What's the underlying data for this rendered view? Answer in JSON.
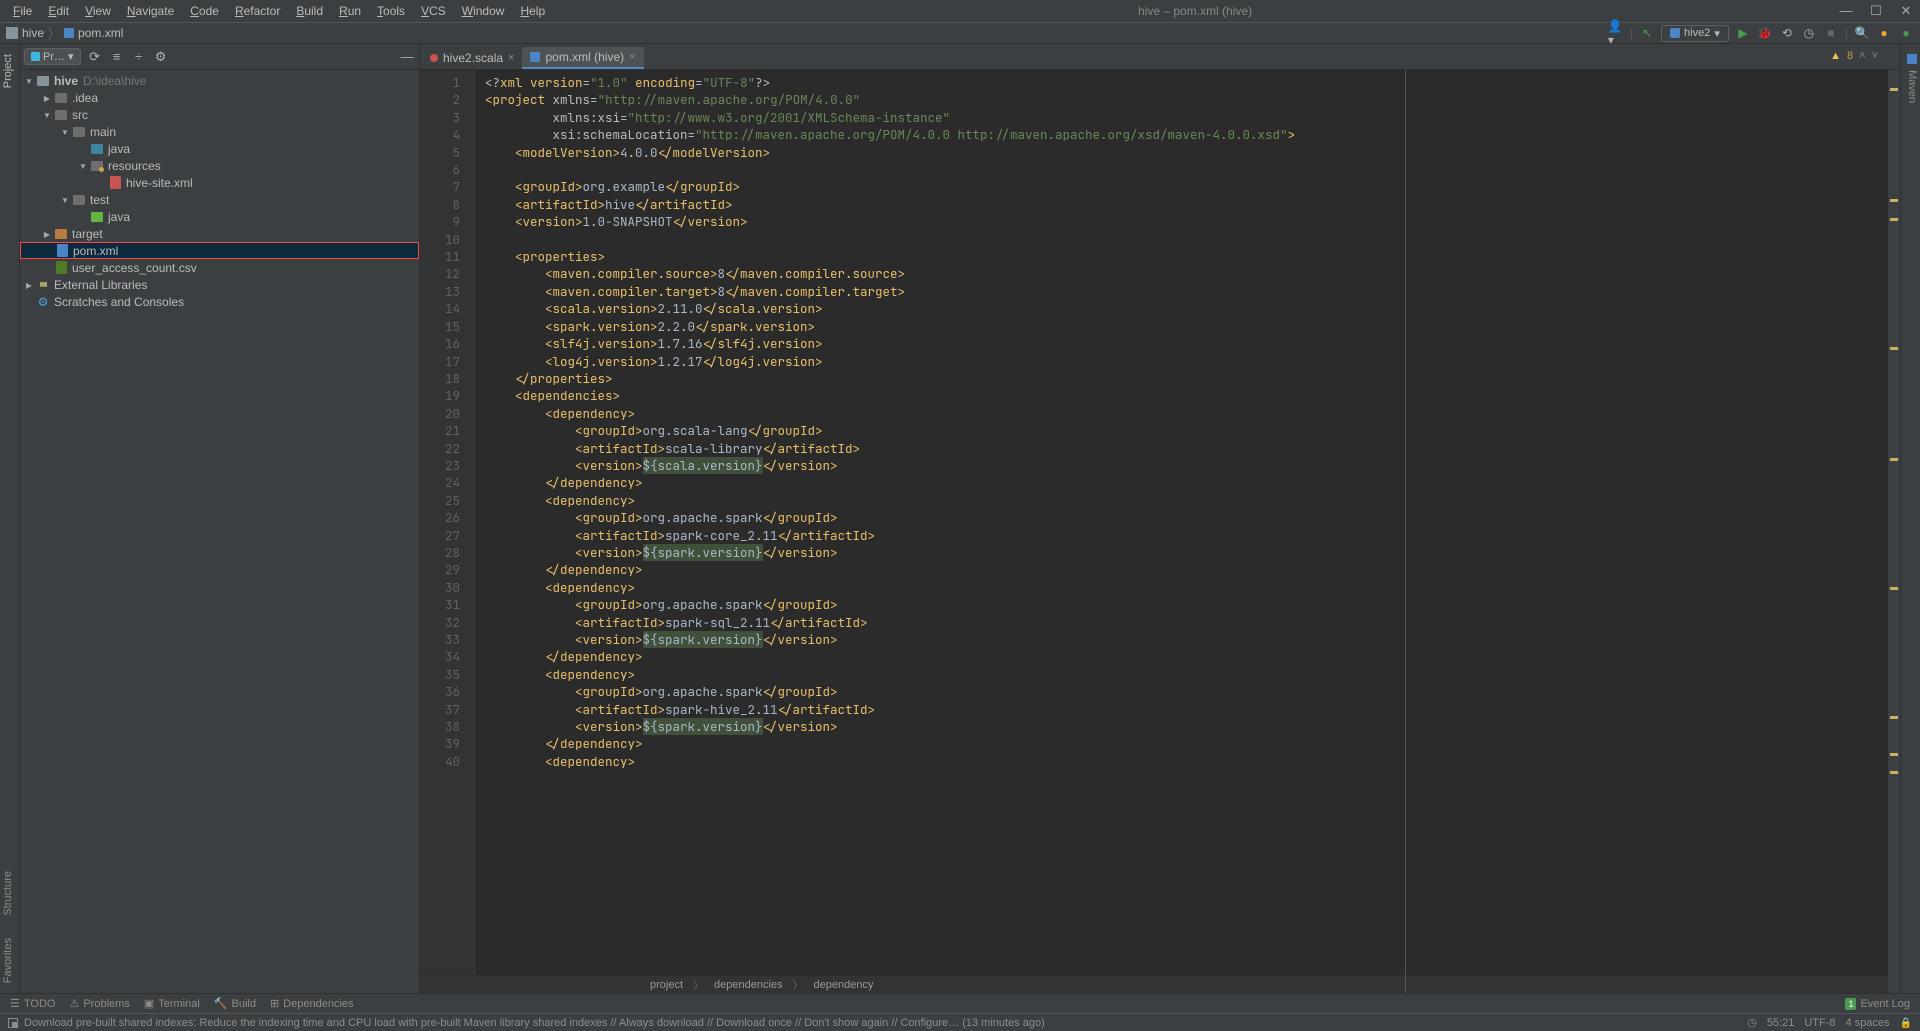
{
  "titlebar": {
    "menu": [
      "File",
      "Edit",
      "View",
      "Navigate",
      "Code",
      "Refactor",
      "Build",
      "Run",
      "Tools",
      "VCS",
      "Window",
      "Help"
    ],
    "center": "hive – pom.xml (hive)"
  },
  "navbar": {
    "crumb1": "hive",
    "crumb2": "pom.xml",
    "run_label": "hive2"
  },
  "project_header": {
    "label": "Pr…"
  },
  "tree": {
    "root": "hive",
    "root_path": "D:\\idea\\hive",
    "idea": ".idea",
    "src": "src",
    "main": "main",
    "java": "java",
    "resources": "resources",
    "hive_site": "hive-site.xml",
    "test": "test",
    "test_java": "java",
    "target": "target",
    "pom": "pom.xml",
    "csv": "user_access_count.csv",
    "libs": "External Libraries",
    "scratches": "Scratches and Consoles"
  },
  "tabs": {
    "t1": "hive2.scala",
    "t2": "pom.xml (hive)"
  },
  "warnings": {
    "count": "8"
  },
  "code_lines": [
    {
      "n": 1,
      "html": "<span class='pi'>&lt;?</span><span class='tag'>xml version</span>=<span class='str'>\"1.0\"</span> <span class='tag'>encoding</span>=<span class='str'>\"UTF-8\"</span><span class='pi'>?&gt;</span>"
    },
    {
      "n": 2,
      "html": "<span class='tag'>&lt;project</span> <span class='attr'>xmlns</span>=<span class='str'>\"http://maven.apache.org/POM/4.0.0\"</span>"
    },
    {
      "n": 3,
      "html": "         <span class='attr'>xmlns:xsi</span>=<span class='str'>\"http://www.w3.org/2001/XMLSchema-instance\"</span>"
    },
    {
      "n": 4,
      "html": "         <span class='attr'>xsi:schemaLocation</span>=<span class='str'>\"http://maven.apache.org/POM/4.0.0 http://maven.apache.org/xsd/maven-4.0.0.xsd\"</span><span class='tag'>&gt;</span>"
    },
    {
      "n": 5,
      "html": "    <span class='tag'>&lt;modelVersion&gt;</span>4.0.0<span class='tag'>&lt;/modelVersion&gt;</span>"
    },
    {
      "n": 6,
      "html": ""
    },
    {
      "n": 7,
      "html": "    <span class='tag'>&lt;groupId&gt;</span>org.example<span class='tag'>&lt;/groupId&gt;</span>"
    },
    {
      "n": 8,
      "html": "    <span class='tag'>&lt;artifactId&gt;</span>hive<span class='tag'>&lt;/artifactId&gt;</span>"
    },
    {
      "n": 9,
      "html": "    <span class='tag'>&lt;version&gt;</span>1.0-SNAPSHOT<span class='tag'>&lt;/version&gt;</span>"
    },
    {
      "n": 10,
      "html": ""
    },
    {
      "n": 11,
      "html": "    <span class='tag'>&lt;properties&gt;</span>"
    },
    {
      "n": 12,
      "html": "        <span class='tag'>&lt;maven.compiler.source&gt;</span>8<span class='tag'>&lt;/maven.compiler.source&gt;</span>"
    },
    {
      "n": 13,
      "html": "        <span class='tag'>&lt;maven.compiler.target&gt;</span>8<span class='tag'>&lt;/maven.compiler.target&gt;</span>"
    },
    {
      "n": 14,
      "html": "        <span class='tag'>&lt;scala.version&gt;</span>2.11.0<span class='tag'>&lt;/scala.version&gt;</span>"
    },
    {
      "n": 15,
      "html": "        <span class='tag'>&lt;spark.version&gt;</span>2.2.0<span class='tag'>&lt;/spark.version&gt;</span>"
    },
    {
      "n": 16,
      "html": "        <span class='tag'>&lt;slf4j.version&gt;</span>1.7.16<span class='tag'>&lt;/slf4j.version&gt;</span>"
    },
    {
      "n": 17,
      "html": "        <span class='tag'>&lt;log4j.version&gt;</span>1.2.17<span class='tag'>&lt;/log4j.version&gt;</span>"
    },
    {
      "n": 18,
      "html": "    <span class='tag'>&lt;/properties&gt;</span>"
    },
    {
      "n": 19,
      "html": "    <span class='tag'>&lt;dependencies&gt;</span>"
    },
    {
      "n": 20,
      "html": "        <span class='tag'>&lt;dependency&gt;</span>"
    },
    {
      "n": 21,
      "html": "            <span class='tag'>&lt;groupId&gt;</span>org.scala-lang<span class='tag'>&lt;/groupId&gt;</span>"
    },
    {
      "n": 22,
      "html": "            <span class='tag'>&lt;artifactId&gt;</span>scala-library<span class='tag'>&lt;/artifactId&gt;</span>"
    },
    {
      "n": 23,
      "html": "            <span class='tag'>&lt;version&gt;</span><span class='var'>${scala.version}</span><span class='tag'>&lt;/version&gt;</span>"
    },
    {
      "n": 24,
      "html": "        <span class='tag'>&lt;/dependency&gt;</span>"
    },
    {
      "n": 25,
      "html": "        <span class='tag'>&lt;dependency&gt;</span>"
    },
    {
      "n": 26,
      "html": "            <span class='tag'>&lt;groupId&gt;</span>org.apache.spark<span class='tag'>&lt;/groupId&gt;</span>"
    },
    {
      "n": 27,
      "html": "            <span class='tag'>&lt;artifactId&gt;</span>spark-core_2.11<span class='tag'>&lt;/artifactId&gt;</span>"
    },
    {
      "n": 28,
      "html": "            <span class='tag'>&lt;version&gt;</span><span class='var'>${spark.version}</span><span class='tag'>&lt;/version&gt;</span>"
    },
    {
      "n": 29,
      "html": "        <span class='tag'>&lt;/dependency&gt;</span>"
    },
    {
      "n": 30,
      "html": "        <span class='tag'>&lt;dependency&gt;</span>"
    },
    {
      "n": 31,
      "html": "            <span class='tag'>&lt;groupId&gt;</span>org.apache.spark<span class='tag'>&lt;/groupId&gt;</span>"
    },
    {
      "n": 32,
      "html": "            <span class='tag'>&lt;artifactId&gt;</span>spark-sql_2.11<span class='tag'>&lt;/artifactId&gt;</span>"
    },
    {
      "n": 33,
      "html": "            <span class='tag'>&lt;version&gt;</span><span class='var'>${spark.version}</span><span class='tag'>&lt;/version&gt;</span>"
    },
    {
      "n": 34,
      "html": "        <span class='tag'>&lt;/dependency&gt;</span>"
    },
    {
      "n": 35,
      "html": "        <span class='tag'>&lt;dependency&gt;</span>"
    },
    {
      "n": 36,
      "html": "            <span class='tag'>&lt;groupId&gt;</span>org.apache.spark<span class='tag'>&lt;/groupId&gt;</span>"
    },
    {
      "n": 37,
      "html": "            <span class='tag'>&lt;artifactId&gt;</span>spark-hive_2.11<span class='tag'>&lt;/artifactId&gt;</span>"
    },
    {
      "n": 38,
      "html": "            <span class='tag'>&lt;version&gt;</span><span class='var'>${spark.version}</span><span class='tag'>&lt;/version&gt;</span>"
    },
    {
      "n": 39,
      "html": "        <span class='tag'>&lt;/dependency&gt;</span>"
    },
    {
      "n": 40,
      "html": "        <span class='tag'>&lt;dependency&gt;</span>"
    }
  ],
  "crumbs": {
    "c1": "project",
    "c2": "dependencies",
    "c3": "dependency"
  },
  "bottom": {
    "todo": "TODO",
    "problems": "Problems",
    "terminal": "Terminal",
    "build": "Build",
    "deps": "Dependencies",
    "eventlog": "Event Log"
  },
  "status": {
    "msg": "Download pre-built shared indexes: Reduce the indexing time and CPU load with pre-built Maven library shared indexes // Always download // Download once // Don't show again // Configure… (13 minutes ago)",
    "pos": "55:21",
    "encoding": "UTF-8",
    "spaces": "4 spaces"
  },
  "right_rail": {
    "maven": "Maven"
  },
  "left_rail": {
    "project": "Project",
    "structure": "Structure",
    "favorites": "Favorites"
  }
}
